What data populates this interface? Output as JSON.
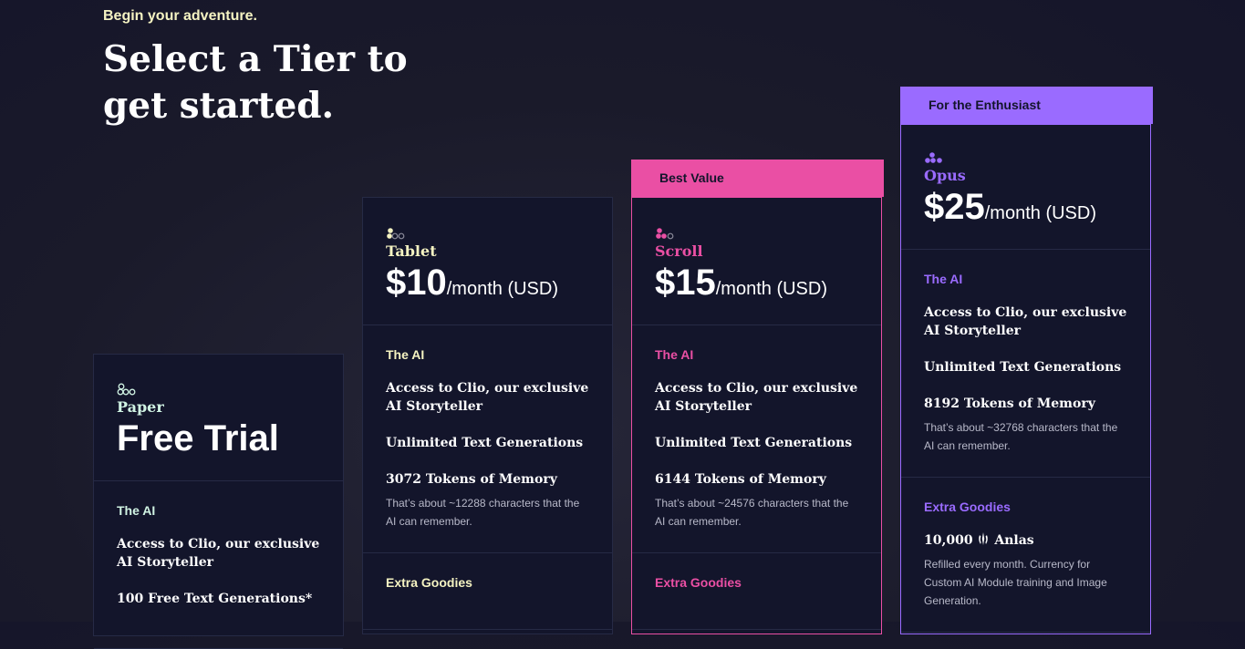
{
  "header": {
    "tagline": "Begin your adventure.",
    "title_line1": "Select a Tier to",
    "title_line2": "get started."
  },
  "colors": {
    "paper": "#d0f3e3",
    "tablet": "#f5f3c2",
    "scroll": "#ea4fa4",
    "opus": "#9a6bff",
    "card_bg": "#13152b"
  },
  "tiers": {
    "paper": {
      "icon": "tier-paper-icon",
      "name": "Paper",
      "price_label": "Free Trial",
      "ai_title": "The AI",
      "features": [
        "Access to Clio, our exclusive AI Storyteller",
        "100 Free Text Generations*"
      ]
    },
    "tablet": {
      "icon": "tier-tablet-icon",
      "name": "Tablet",
      "price": "$10",
      "period": "/month (USD)",
      "ai_title": "The AI",
      "features": [
        "Access to Clio, our exclusive AI Storyteller",
        "Unlimited Text Generations",
        "3072 Tokens of Memory"
      ],
      "memory_note": "That’s about ~12288 characters that the AI can remember.",
      "extras_title": "Extra Goodies"
    },
    "scroll": {
      "banner": "Best Value",
      "icon": "tier-scroll-icon",
      "name": "Scroll",
      "price": "$15",
      "period": "/month (USD)",
      "ai_title": "The AI",
      "features": [
        "Access to Clio, our exclusive AI Storyteller",
        "Unlimited Text Generations",
        "6144 Tokens of Memory"
      ],
      "memory_note": "That’s about ~24576 characters that the AI can remember.",
      "extras_title": "Extra Goodies"
    },
    "opus": {
      "banner": "For the Enthusiast",
      "icon": "tier-opus-icon",
      "name": "Opus",
      "price": "$25",
      "period": "/month (USD)",
      "ai_title": "The AI",
      "features": [
        "Access to Clio, our exclusive AI Storyteller",
        "Unlimited Text Generations",
        "8192 Tokens of Memory"
      ],
      "memory_note": "That’s about ~32768 characters that the AI can remember.",
      "extras_title": "Extra Goodies",
      "anlas_amount": "10,000",
      "anlas_label": "Anlas",
      "anlas_icon": "anlas-icon",
      "anlas_note": "Refilled every month. Currency for Custom AI Module training and Image Generation."
    }
  }
}
